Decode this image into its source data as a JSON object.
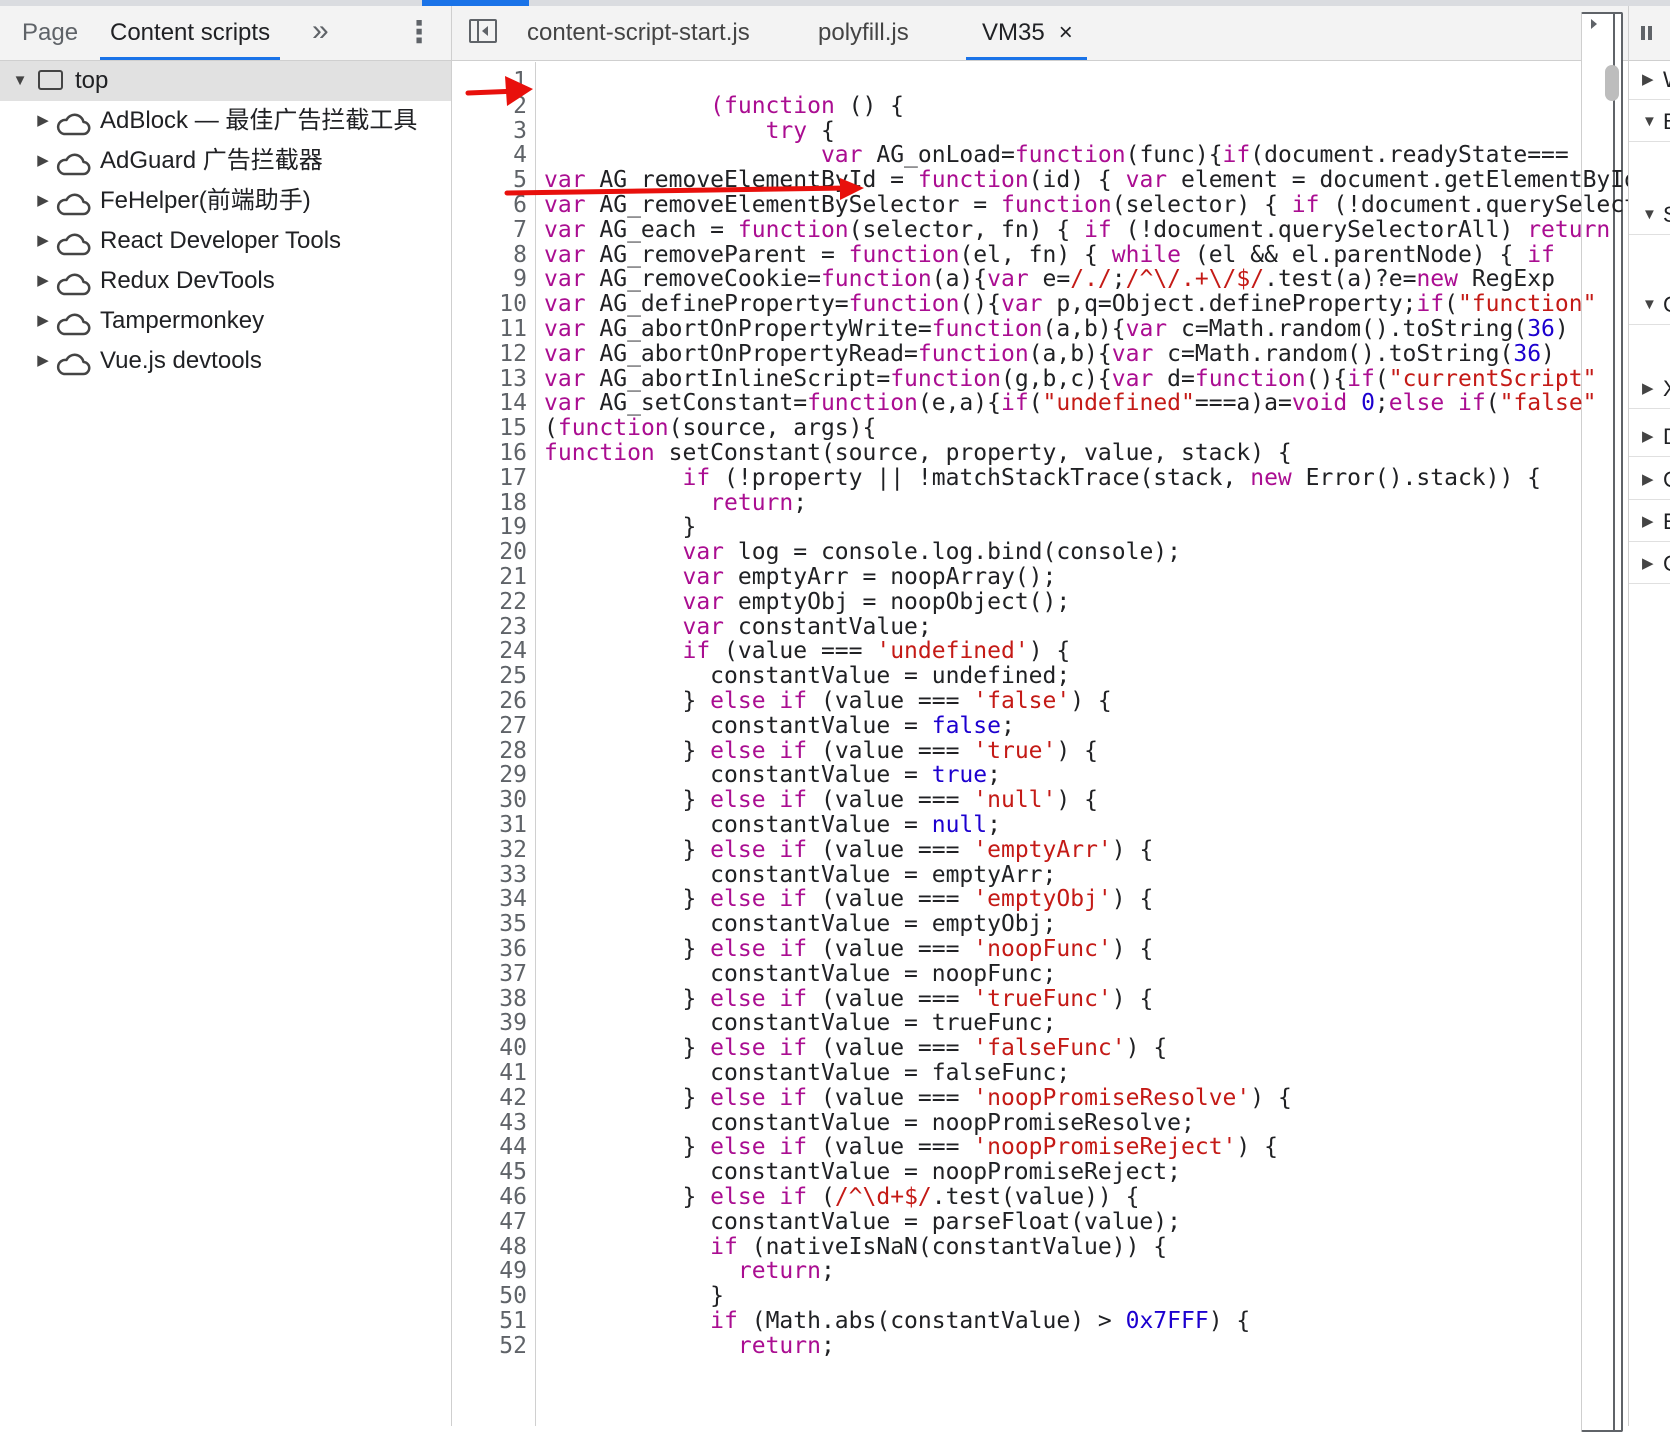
{
  "navigator": {
    "tabs": {
      "page": "Page",
      "content_scripts": "Content scripts",
      "more": "»",
      "menu": "⋮"
    },
    "top": {
      "label": "top",
      "toggle": "▼"
    },
    "extensions": [
      {
        "label": "AdBlock — 最佳广告拦截工具",
        "toggle": "▶"
      },
      {
        "label": "AdGuard 广告拦截器",
        "toggle": "▶"
      },
      {
        "label": "FeHelper(前端助手)",
        "toggle": "▶"
      },
      {
        "label": "React Developer Tools",
        "toggle": "▶"
      },
      {
        "label": "Redux DevTools",
        "toggle": "▶"
      },
      {
        "label": "Tampermonkey",
        "toggle": "▶"
      },
      {
        "label": "Vue.js devtools",
        "toggle": "▶"
      }
    ]
  },
  "editor": {
    "tabs": [
      {
        "label": "content-script-start.js"
      },
      {
        "label": "polyfill.js"
      },
      {
        "label": "VM35",
        "close": "×"
      }
    ],
    "lines": [
      [],
      [
        [
          "t",
          "            "
        ],
        [
          "k",
          "(function"
        ],
        [
          "t",
          " () {"
        ]
      ],
      [
        [
          "t",
          "                "
        ],
        [
          "k",
          "try"
        ],
        [
          "t",
          " {"
        ]
      ],
      [
        [
          "t",
          "                    "
        ],
        [
          "k",
          "var"
        ],
        [
          "t",
          " AG_onLoad="
        ],
        [
          "k",
          "function"
        ],
        [
          "t",
          "(func){"
        ],
        [
          "k",
          "if"
        ],
        [
          "t",
          "(document.readyState==="
        ]
      ],
      [
        [
          "k",
          "var"
        ],
        [
          "t",
          " AG_removeElementById = "
        ],
        [
          "k",
          "function"
        ],
        [
          "t",
          "(id) { "
        ],
        [
          "k",
          "var"
        ],
        [
          "t",
          " element = document.getElementById(id);"
        ]
      ],
      [
        [
          "k",
          "var"
        ],
        [
          "t",
          " AG_removeElementBySelector = "
        ],
        [
          "k",
          "function"
        ],
        [
          "t",
          "(selector) { "
        ],
        [
          "k",
          "if"
        ],
        [
          "t",
          " (!document.querySelectorAll)"
        ]
      ],
      [
        [
          "k",
          "var"
        ],
        [
          "t",
          " AG_each = "
        ],
        [
          "k",
          "function"
        ],
        [
          "t",
          "(selector, fn) { "
        ],
        [
          "k",
          "if"
        ],
        [
          "t",
          " (!document.querySelectorAll) "
        ],
        [
          "k",
          "return"
        ]
      ],
      [
        [
          "k",
          "var"
        ],
        [
          "t",
          " AG_removeParent = "
        ],
        [
          "k",
          "function"
        ],
        [
          "t",
          "(el, fn) { "
        ],
        [
          "k",
          "while"
        ],
        [
          "t",
          " (el && el.parentNode) { "
        ],
        [
          "k",
          "if"
        ]
      ],
      [
        [
          "k",
          "var"
        ],
        [
          "t",
          " AG_removeCookie="
        ],
        [
          "k",
          "function"
        ],
        [
          "t",
          "(a){"
        ],
        [
          "k",
          "var"
        ],
        [
          "t",
          " e="
        ],
        [
          "s",
          "/./"
        ],
        [
          "t",
          ";"
        ],
        [
          "s",
          "/^\\/.+\\/$/"
        ],
        [
          "t",
          ".test(a)?e="
        ],
        [
          "k",
          "new"
        ],
        [
          "t",
          " RegExp"
        ]
      ],
      [
        [
          "k",
          "var"
        ],
        [
          "t",
          " AG_defineProperty="
        ],
        [
          "k",
          "function"
        ],
        [
          "t",
          "(){"
        ],
        [
          "k",
          "var"
        ],
        [
          "t",
          " p,q=Object.defineProperty;"
        ],
        [
          "k",
          "if"
        ],
        [
          "t",
          "("
        ],
        [
          "s",
          "\"function\""
        ]
      ],
      [
        [
          "k",
          "var"
        ],
        [
          "t",
          " AG_abortOnPropertyWrite="
        ],
        [
          "k",
          "function"
        ],
        [
          "t",
          "(a,b){"
        ],
        [
          "k",
          "var"
        ],
        [
          "t",
          " c=Math.random().toString("
        ],
        [
          "n",
          "36"
        ],
        [
          "t",
          ")"
        ]
      ],
      [
        [
          "k",
          "var"
        ],
        [
          "t",
          " AG_abortOnPropertyRead="
        ],
        [
          "k",
          "function"
        ],
        [
          "t",
          "(a,b){"
        ],
        [
          "k",
          "var"
        ],
        [
          "t",
          " c=Math.random().toString("
        ],
        [
          "n",
          "36"
        ],
        [
          "t",
          ")"
        ]
      ],
      [
        [
          "k",
          "var"
        ],
        [
          "t",
          " AG_abortInlineScript="
        ],
        [
          "k",
          "function"
        ],
        [
          "t",
          "(g,b,c){"
        ],
        [
          "k",
          "var"
        ],
        [
          "t",
          " d="
        ],
        [
          "k",
          "function"
        ],
        [
          "t",
          "(){"
        ],
        [
          "k",
          "if"
        ],
        [
          "t",
          "("
        ],
        [
          "s",
          "\"currentScript\""
        ]
      ],
      [
        [
          "k",
          "var"
        ],
        [
          "t",
          " AG_setConstant="
        ],
        [
          "k",
          "function"
        ],
        [
          "t",
          "(e,a){"
        ],
        [
          "k",
          "if"
        ],
        [
          "t",
          "("
        ],
        [
          "s",
          "\"undefined\""
        ],
        [
          "t",
          "===a)a="
        ],
        [
          "k",
          "void"
        ],
        [
          "t",
          " "
        ],
        [
          "n",
          "0"
        ],
        [
          "t",
          ";"
        ],
        [
          "k",
          "else"
        ],
        [
          "t",
          " "
        ],
        [
          "k",
          "if"
        ],
        [
          "t",
          "("
        ],
        [
          "s",
          "\"false\""
        ]
      ],
      [
        [
          "t",
          "("
        ],
        [
          "k",
          "function"
        ],
        [
          "t",
          "(source, args){"
        ]
      ],
      [
        [
          "k",
          "function"
        ],
        [
          "t",
          " setConstant(source, property, value, stack) {"
        ]
      ],
      [
        [
          "t",
          "          "
        ],
        [
          "k",
          "if"
        ],
        [
          "t",
          " (!property || !matchStackTrace(stack, "
        ],
        [
          "k",
          "new"
        ],
        [
          "t",
          " Error().stack)) {"
        ]
      ],
      [
        [
          "t",
          "            "
        ],
        [
          "k",
          "return"
        ],
        [
          "t",
          ";"
        ]
      ],
      [
        [
          "t",
          "          }"
        ]
      ],
      [
        [
          "t",
          "          "
        ],
        [
          "k",
          "var"
        ],
        [
          "t",
          " log = console.log.bind(console);"
        ]
      ],
      [
        [
          "t",
          "          "
        ],
        [
          "k",
          "var"
        ],
        [
          "t",
          " emptyArr = noopArray();"
        ]
      ],
      [
        [
          "t",
          "          "
        ],
        [
          "k",
          "var"
        ],
        [
          "t",
          " emptyObj = noopObject();"
        ]
      ],
      [
        [
          "t",
          "          "
        ],
        [
          "k",
          "var"
        ],
        [
          "t",
          " constantValue;"
        ]
      ],
      [
        [
          "t",
          "          "
        ],
        [
          "k",
          "if"
        ],
        [
          "t",
          " (value === "
        ],
        [
          "s",
          "'undefined'"
        ],
        [
          "t",
          ") {"
        ]
      ],
      [
        [
          "t",
          "            constantValue = undefined;"
        ]
      ],
      [
        [
          "t",
          "          } "
        ],
        [
          "k",
          "else"
        ],
        [
          "t",
          " "
        ],
        [
          "k",
          "if"
        ],
        [
          "t",
          " (value === "
        ],
        [
          "s",
          "'false'"
        ],
        [
          "t",
          ") {"
        ]
      ],
      [
        [
          "t",
          "            constantValue = "
        ],
        [
          "n",
          "false"
        ],
        [
          "t",
          ";"
        ]
      ],
      [
        [
          "t",
          "          } "
        ],
        [
          "k",
          "else"
        ],
        [
          "t",
          " "
        ],
        [
          "k",
          "if"
        ],
        [
          "t",
          " (value === "
        ],
        [
          "s",
          "'true'"
        ],
        [
          "t",
          ") {"
        ]
      ],
      [
        [
          "t",
          "            constantValue = "
        ],
        [
          "n",
          "true"
        ],
        [
          "t",
          ";"
        ]
      ],
      [
        [
          "t",
          "          } "
        ],
        [
          "k",
          "else"
        ],
        [
          "t",
          " "
        ],
        [
          "k",
          "if"
        ],
        [
          "t",
          " (value === "
        ],
        [
          "s",
          "'null'"
        ],
        [
          "t",
          ") {"
        ]
      ],
      [
        [
          "t",
          "            constantValue = "
        ],
        [
          "n",
          "null"
        ],
        [
          "t",
          ";"
        ]
      ],
      [
        [
          "t",
          "          } "
        ],
        [
          "k",
          "else"
        ],
        [
          "t",
          " "
        ],
        [
          "k",
          "if"
        ],
        [
          "t",
          " (value === "
        ],
        [
          "s",
          "'emptyArr'"
        ],
        [
          "t",
          ") {"
        ]
      ],
      [
        [
          "t",
          "            constantValue = emptyArr;"
        ]
      ],
      [
        [
          "t",
          "          } "
        ],
        [
          "k",
          "else"
        ],
        [
          "t",
          " "
        ],
        [
          "k",
          "if"
        ],
        [
          "t",
          " (value === "
        ],
        [
          "s",
          "'emptyObj'"
        ],
        [
          "t",
          ") {"
        ]
      ],
      [
        [
          "t",
          "            constantValue = emptyObj;"
        ]
      ],
      [
        [
          "t",
          "          } "
        ],
        [
          "k",
          "else"
        ],
        [
          "t",
          " "
        ],
        [
          "k",
          "if"
        ],
        [
          "t",
          " (value === "
        ],
        [
          "s",
          "'noopFunc'"
        ],
        [
          "t",
          ") {"
        ]
      ],
      [
        [
          "t",
          "            constantValue = noopFunc;"
        ]
      ],
      [
        [
          "t",
          "          } "
        ],
        [
          "k",
          "else"
        ],
        [
          "t",
          " "
        ],
        [
          "k",
          "if"
        ],
        [
          "t",
          " (value === "
        ],
        [
          "s",
          "'trueFunc'"
        ],
        [
          "t",
          ") {"
        ]
      ],
      [
        [
          "t",
          "            constantValue = trueFunc;"
        ]
      ],
      [
        [
          "t",
          "          } "
        ],
        [
          "k",
          "else"
        ],
        [
          "t",
          " "
        ],
        [
          "k",
          "if"
        ],
        [
          "t",
          " (value === "
        ],
        [
          "s",
          "'falseFunc'"
        ],
        [
          "t",
          ") {"
        ]
      ],
      [
        [
          "t",
          "            constantValue = falseFunc;"
        ]
      ],
      [
        [
          "t",
          "          } "
        ],
        [
          "k",
          "else"
        ],
        [
          "t",
          " "
        ],
        [
          "k",
          "if"
        ],
        [
          "t",
          " (value === "
        ],
        [
          "s",
          "'noopPromiseResolve'"
        ],
        [
          "t",
          ") {"
        ]
      ],
      [
        [
          "t",
          "            constantValue = noopPromiseResolve;"
        ]
      ],
      [
        [
          "t",
          "          } "
        ],
        [
          "k",
          "else"
        ],
        [
          "t",
          " "
        ],
        [
          "k",
          "if"
        ],
        [
          "t",
          " (value === "
        ],
        [
          "s",
          "'noopPromiseReject'"
        ],
        [
          "t",
          ") {"
        ]
      ],
      [
        [
          "t",
          "            constantValue = noopPromiseReject;"
        ]
      ],
      [
        [
          "t",
          "          } "
        ],
        [
          "k",
          "else"
        ],
        [
          "t",
          " "
        ],
        [
          "k",
          "if"
        ],
        [
          "t",
          " ("
        ],
        [
          "s",
          "/^\\d+$/"
        ],
        [
          "t",
          ".test(value)) {"
        ]
      ],
      [
        [
          "t",
          "            constantValue = parseFloat(value);"
        ]
      ],
      [
        [
          "t",
          "            "
        ],
        [
          "k",
          "if"
        ],
        [
          "t",
          " (nativeIsNaN(constantValue)) {"
        ]
      ],
      [
        [
          "t",
          "              "
        ],
        [
          "k",
          "return"
        ],
        [
          "t",
          ";"
        ]
      ],
      [
        [
          "t",
          "            }"
        ]
      ],
      [
        [
          "t",
          "            "
        ],
        [
          "k",
          "if"
        ],
        [
          "t",
          " (Math.abs(constantValue) > "
        ],
        [
          "n",
          "0x7FFF"
        ],
        [
          "t",
          ") {"
        ]
      ],
      [
        [
          "t",
          "              "
        ],
        [
          "k",
          "return"
        ],
        [
          "t",
          ";"
        ]
      ]
    ]
  },
  "sidebar": {
    "sections": [
      {
        "toggle": "▶",
        "label": "W"
      },
      {
        "toggle": "▼",
        "label": "B"
      },
      {
        "toggle": "▼",
        "label": "S"
      },
      {
        "toggle": "▼",
        "label": "C"
      },
      {
        "toggle": "▶",
        "label": "X"
      },
      {
        "toggle": "▶",
        "label": "D"
      },
      {
        "toggle": "▶",
        "label": "G"
      },
      {
        "toggle": "▶",
        "label": "E"
      },
      {
        "toggle": "▶",
        "label": "C"
      }
    ]
  },
  "colors": {
    "keyword": "#aa0d91",
    "string": "#c41a16",
    "number": "#1c00cf",
    "accent": "#1a73e8",
    "annotation": "#e8100c"
  }
}
